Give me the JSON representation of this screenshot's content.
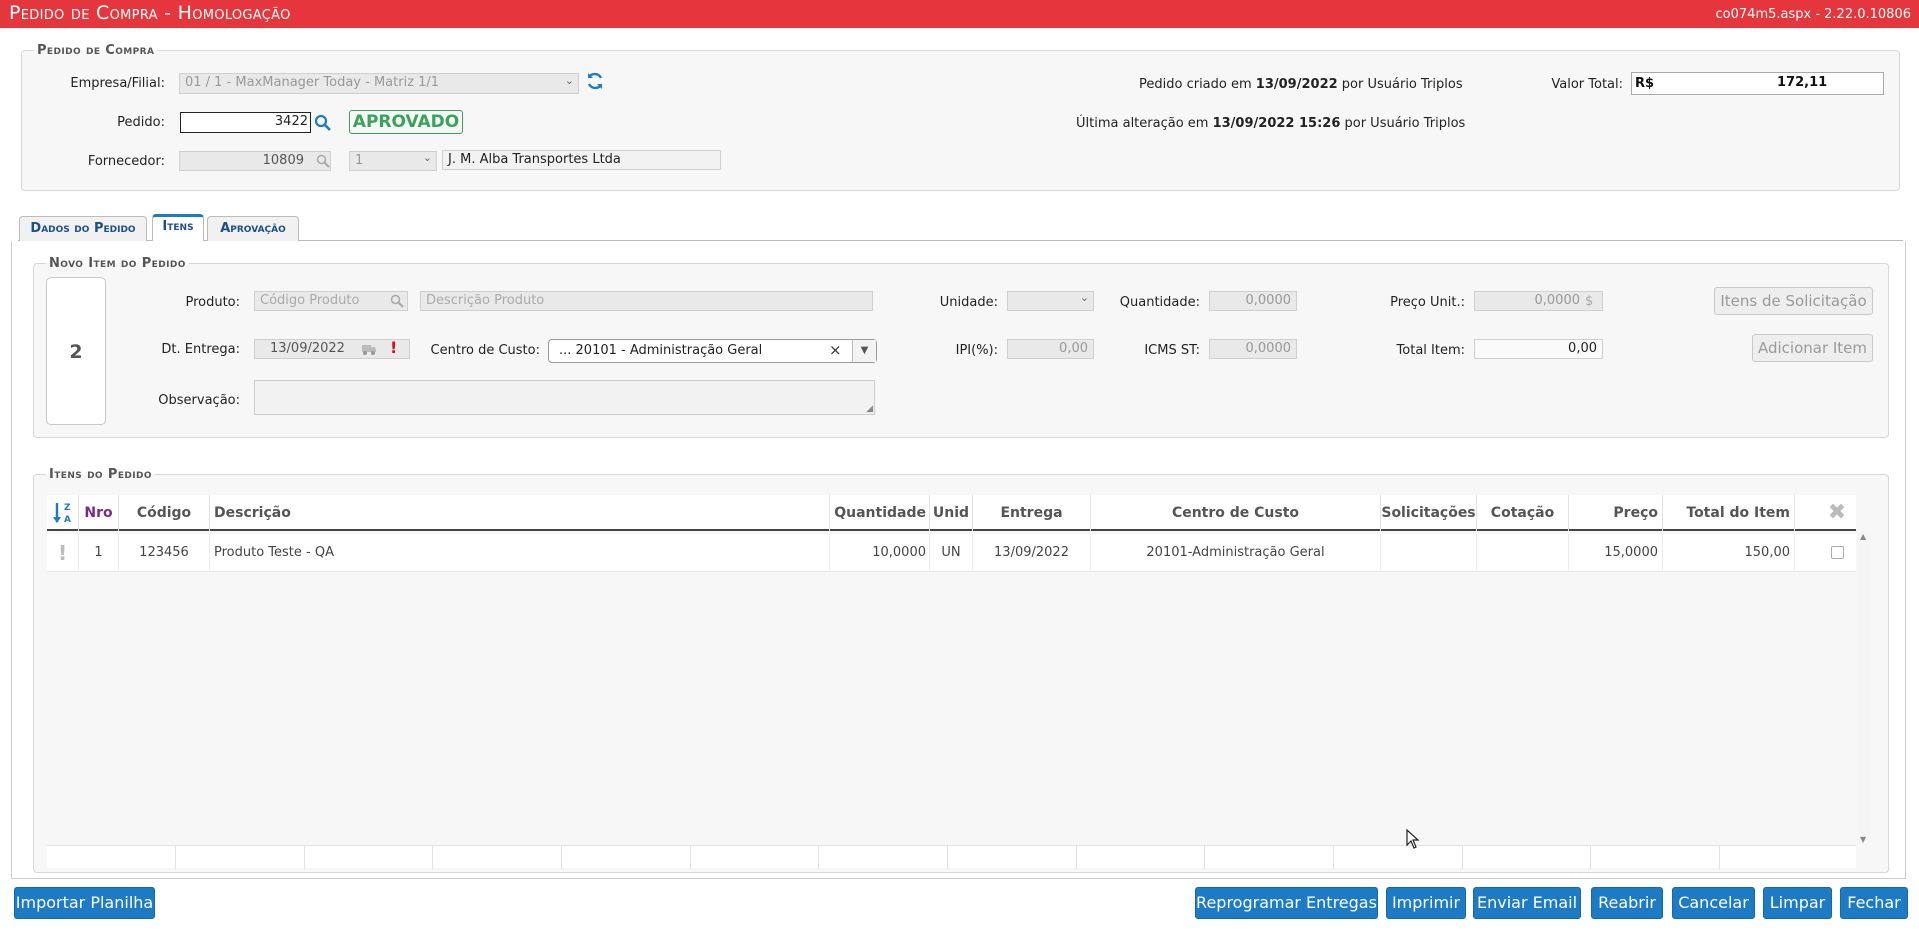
{
  "header": {
    "title": "Pedido de Compra  - Homologação",
    "version": "co074m5.aspx - 2.22.0.10806"
  },
  "pedido_compra": {
    "legend": "Pedido de Compra",
    "empresa_label": "Empresa/Filial:",
    "empresa_value": "01 / 1 - MaxManager Today - Matriz 1/1",
    "pedido_label": "Pedido:",
    "pedido_value": "3422",
    "status": "APROVADO",
    "fornecedor_label": "Fornecedor:",
    "fornecedor_code": "10809",
    "fornecedor_seq": "1",
    "fornecedor_name": "J. M. Alba Transportes Ltda",
    "criado_prefix": "Pedido criado em",
    "criado_date": "13/09/2022",
    "criado_suffix": "por Usuário Triplos",
    "alterado_prefix": "Última alteração em",
    "alterado_date": "13/09/2022 15:26",
    "alterado_suffix": "por Usuário Triplos",
    "valor_label": "Valor Total:",
    "valor_currency": "R$",
    "valor_value": "172,11"
  },
  "tabs": [
    {
      "label": "Dados do Pedido"
    },
    {
      "label": "Itens"
    },
    {
      "label": "Aprovação"
    }
  ],
  "novo_item": {
    "legend": "Novo Item do Pedido",
    "item_number": "2",
    "produto_label": "Produto:",
    "codigo_placeholder": "Código Produto",
    "descricao_placeholder": "Descrição Produto",
    "unidade_label": "Unidade:",
    "quantidade_label": "Quantidade:",
    "quantidade_value": "0,0000",
    "preco_label": "Preço Unit.:",
    "preco_value": "0,0000",
    "preco_icon": "$",
    "itens_solicitacao_button": "Itens de Solicitação",
    "entrega_label": "Dt. Entrega:",
    "entrega_value": "13/09/2022",
    "centro_label": "Centro de Custo:",
    "centro_value": "... 20101 - Administração Geral",
    "ipi_label": "IPI(%):",
    "ipi_value": "0,00",
    "icms_label": "ICMS ST:",
    "icms_value": "0,0000",
    "total_label": "Total Item:",
    "total_value": "0,00",
    "adicionar_button": "Adicionar Item",
    "observacao_label": "Observação:"
  },
  "itens_pedido": {
    "legend": "Itens do Pedido",
    "columns": {
      "nro": "Nro",
      "codigo": "Código",
      "descricao": "Descrição",
      "quantidade": "Quantidade",
      "unid": "Unid",
      "entrega": "Entrega",
      "centro": "Centro de Custo",
      "solicitacoes": "Solicitações",
      "cotacao": "Cotação",
      "preco": "Preço",
      "total": "Total do Item"
    },
    "rows": [
      {
        "flag": "!",
        "nro": "1",
        "codigo": "123456",
        "descricao": "Produto Teste - QA",
        "quantidade": "10,0000",
        "unid": "UN",
        "entrega": "13/09/2022",
        "centro": "20101-Administração Geral",
        "solicitacoes": "",
        "cotacao": "",
        "preco": "15,0000",
        "total": "150,00"
      }
    ]
  },
  "footer": {
    "importar": "Importar Planilha",
    "reprogramar": "Reprogramar Entregas",
    "imprimir": "Imprimir",
    "enviar": "Enviar Email",
    "reabrir": "Reabrir",
    "cancelar": "Cancelar",
    "limpar": "Limpar",
    "fechar": "Fechar"
  },
  "colors": {
    "header_bg": "#e5363d",
    "accent_blue": "#1c7bc4",
    "approved_green": "#3aa35b",
    "column_nro_purple": "#7b2a8c",
    "alert_red": "#d0121b"
  }
}
